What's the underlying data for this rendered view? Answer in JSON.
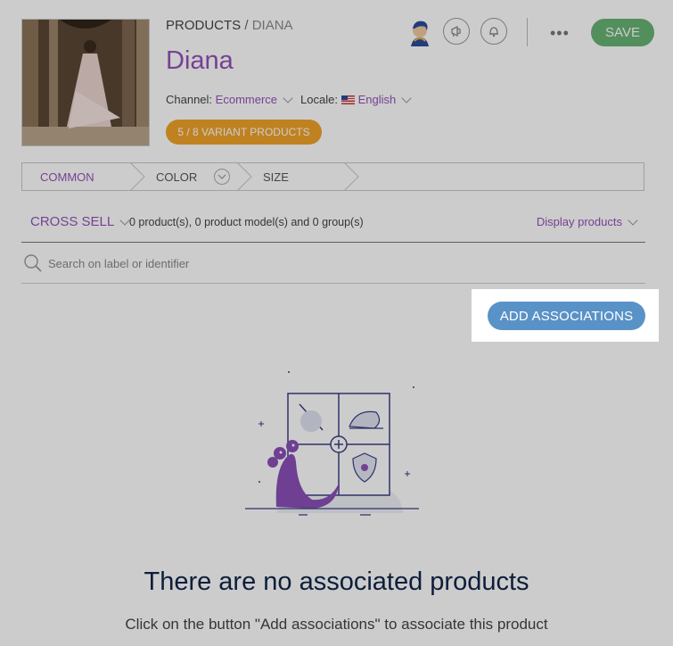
{
  "header": {
    "breadcrumb_root": "PRODUCTS",
    "breadcrumb_separator": "/",
    "breadcrumb_current": "DIANA",
    "title": "Diana",
    "channel_label": "Channel:",
    "channel_value": "Ecommerce",
    "locale_label": "Locale:",
    "locale_value": "English",
    "variant_badge": "5 / 8 VARIANT PRODUCTS",
    "save_label": "SAVE",
    "more_label": "•••"
  },
  "tabs": [
    {
      "label": "COMMON"
    },
    {
      "label": "COLOR"
    },
    {
      "label": "SIZE"
    }
  ],
  "associations": {
    "type_label": "CROSS SELL",
    "count_text": "0 product(s), 0 product model(s) and 0 group(s)",
    "display_label": "Display products",
    "search_placeholder": "Search on label or identifier",
    "add_button_label": "ADD ASSOCIATIONS"
  },
  "empty_state": {
    "title": "There are no associated products",
    "subtitle": "Click on the button \"Add associations\" to associate this product"
  },
  "icons": {
    "user": "user-avatar-icon",
    "announcements": "megaphone-icon",
    "notifications": "bell-icon",
    "search": "search-icon",
    "flag": "us-flag-icon"
  },
  "colors": {
    "brand_purple": "#9452ba",
    "save_green": "#67b373",
    "badge_orange": "#f0a32a",
    "add_blue": "#5992c7",
    "title_navy": "#11264a"
  }
}
